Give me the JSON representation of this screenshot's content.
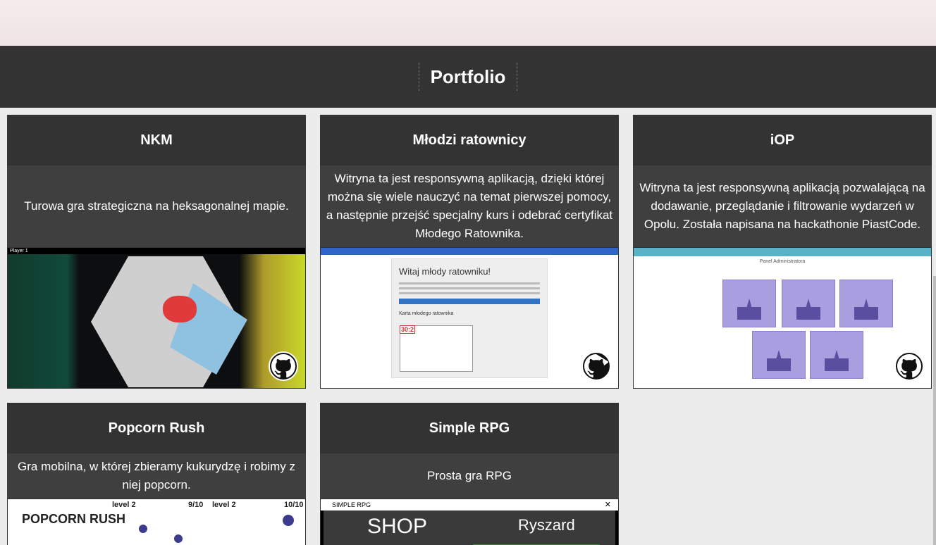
{
  "header": {
    "title": "Portfolio"
  },
  "projects": [
    {
      "title": "NKM",
      "description": "Turowa gra strategiczna na heksagonalnej mapie.",
      "screenshot_text": "Player 1"
    },
    {
      "title": "Młodzi ratownicy",
      "description": "Witryna ta jest responsywną aplikacją, dzięki której można się wiele nauczyć na temat pierwszej pomocy, a następnie przejść specjalny kurs i odebrać certyfikat Młodego Ratownika.",
      "screenshot_heading": "Witaj młody ratowniku!",
      "screenshot_subheading": "Karta młodego ratownika",
      "screenshot_score": "30:2"
    },
    {
      "title": "iOP",
      "description": "Witryna ta jest responsywną aplikacją pozwalającą na dodawanie, przeglądanie i filtrowanie wydarzeń w Opolu. Została napisana na hackathonie PiastCode.",
      "screenshot_heading": "Panel Administratora"
    },
    {
      "title": "Popcorn Rush",
      "description": "Gra mobilna, w której zbieramy kukurydzę i robimy z niej popcorn.",
      "screenshot_logo": "POPCORN RUSH",
      "screenshot_level_1": "level 2",
      "screenshot_score_1": "9/10",
      "screenshot_level_2": "level 2",
      "screenshot_score_2": "10/10"
    },
    {
      "title": "Simple RPG",
      "description": "Prosta gra RPG",
      "screenshot_window_title": "SIMPLE RPG",
      "screenshot_shop": "SHOP",
      "screenshot_player": "Ryszard"
    }
  ],
  "icons": {
    "repo_link": "github-icon"
  },
  "colors": {
    "header_bg": "#333333",
    "card_bg": "#3f3f3f",
    "page_bg": "#ececec"
  }
}
